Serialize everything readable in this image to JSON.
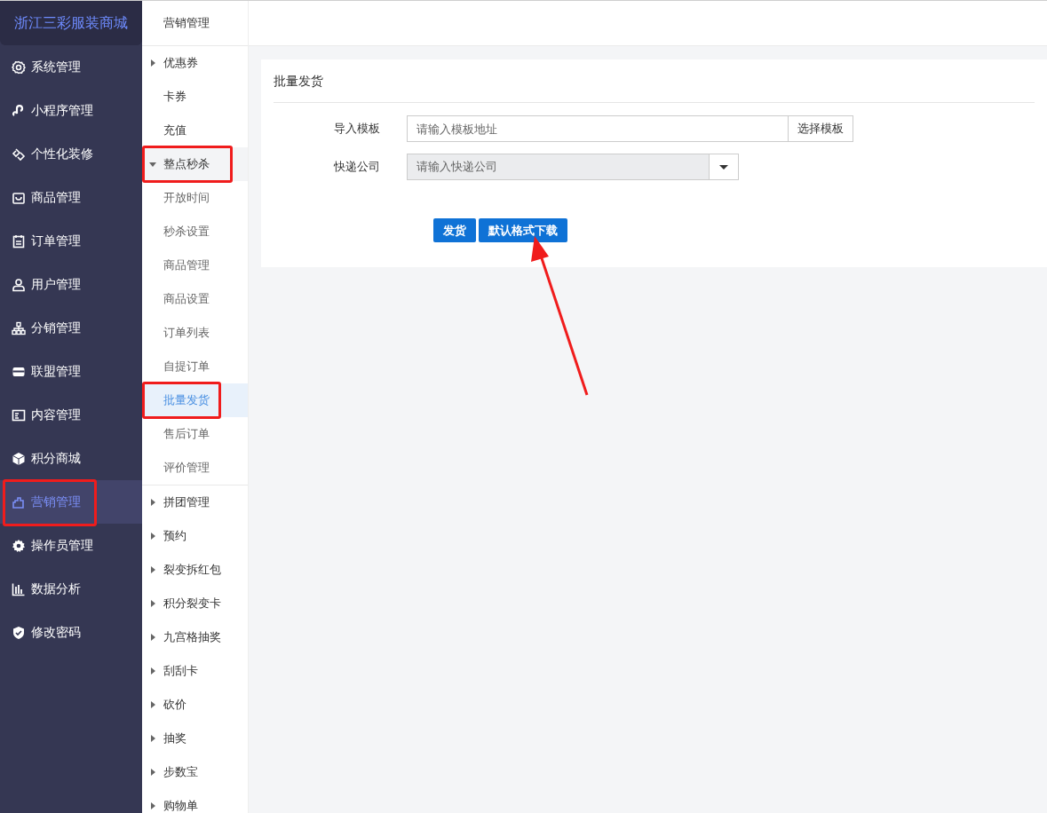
{
  "brand": "浙江三彩服装商城",
  "sidebar": {
    "items": [
      {
        "label": "系统管理",
        "selected": false,
        "highlighted": false
      },
      {
        "label": "小程序管理",
        "selected": false,
        "highlighted": false
      },
      {
        "label": "个性化装修",
        "selected": false,
        "highlighted": false
      },
      {
        "label": "商品管理",
        "selected": false,
        "highlighted": false
      },
      {
        "label": "订单管理",
        "selected": false,
        "highlighted": false
      },
      {
        "label": "用户管理",
        "selected": false,
        "highlighted": false
      },
      {
        "label": "分销管理",
        "selected": false,
        "highlighted": false
      },
      {
        "label": "联盟管理",
        "selected": false,
        "highlighted": false
      },
      {
        "label": "内容管理",
        "selected": false,
        "highlighted": false
      },
      {
        "label": "积分商城",
        "selected": false,
        "highlighted": false
      },
      {
        "label": "营销管理",
        "selected": true,
        "highlighted": true
      },
      {
        "label": "操作员管理",
        "selected": false,
        "highlighted": false
      },
      {
        "label": "数据分析",
        "selected": false,
        "highlighted": false
      },
      {
        "label": "修改密码",
        "selected": false,
        "highlighted": false
      }
    ]
  },
  "submenu": {
    "title": "营销管理",
    "items": [
      {
        "label": "优惠券",
        "kind": "group",
        "expanded": false,
        "highlighted": false
      },
      {
        "label": "卡券",
        "kind": "leaf",
        "selected": false,
        "highlighted": false
      },
      {
        "label": "充值",
        "kind": "leaf",
        "selected": false,
        "highlighted": false
      },
      {
        "label": "整点秒杀",
        "kind": "group",
        "expanded": true,
        "highlighted": true,
        "children": [
          {
            "label": "开放时间",
            "selected": false,
            "highlighted": false
          },
          {
            "label": "秒杀设置",
            "selected": false,
            "highlighted": false
          },
          {
            "label": "商品管理",
            "selected": false,
            "highlighted": false
          },
          {
            "label": "商品设置",
            "selected": false,
            "highlighted": false
          },
          {
            "label": "订单列表",
            "selected": false,
            "highlighted": false
          },
          {
            "label": "自提订单",
            "selected": false,
            "highlighted": false
          },
          {
            "label": "批量发货",
            "selected": true,
            "highlighted": true
          },
          {
            "label": "售后订单",
            "selected": false,
            "highlighted": false
          },
          {
            "label": "评价管理",
            "selected": false,
            "highlighted": false
          }
        ]
      },
      {
        "label": "拼团管理",
        "kind": "group",
        "expanded": false,
        "highlighted": false
      },
      {
        "label": "预约",
        "kind": "group",
        "expanded": false,
        "highlighted": false
      },
      {
        "label": "裂变拆红包",
        "kind": "group",
        "expanded": false,
        "highlighted": false
      },
      {
        "label": "积分裂变卡",
        "kind": "group",
        "expanded": false,
        "highlighted": false
      },
      {
        "label": "九宫格抽奖",
        "kind": "group",
        "expanded": false,
        "highlighted": false
      },
      {
        "label": "刮刮卡",
        "kind": "group",
        "expanded": false,
        "highlighted": false
      },
      {
        "label": "砍价",
        "kind": "group",
        "expanded": false,
        "highlighted": false
      },
      {
        "label": "抽奖",
        "kind": "group",
        "expanded": false,
        "highlighted": false
      },
      {
        "label": "步数宝",
        "kind": "group",
        "expanded": false,
        "highlighted": false
      },
      {
        "label": "购物单",
        "kind": "group",
        "expanded": false,
        "highlighted": false
      }
    ]
  },
  "panel": {
    "title": "批量发货",
    "fields": [
      {
        "label": "导入模板",
        "kind": "file",
        "placeholder": "请输入模板地址",
        "button": "选择模板"
      },
      {
        "label": "快递公司",
        "kind": "select",
        "placeholder": "请输入快递公司"
      }
    ],
    "buttons": [
      "发货",
      "默认格式下载"
    ]
  }
}
